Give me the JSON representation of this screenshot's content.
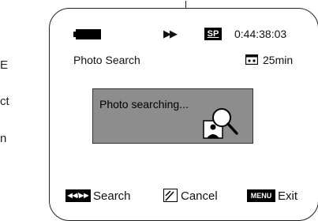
{
  "page": {
    "margin_letters": [
      "E",
      "ct",
      "n"
    ]
  },
  "status": {
    "tape_mode": "SP",
    "timecode": "0:44:38:03",
    "remaining": "25min",
    "play_symbol": "▶▶"
  },
  "screen": {
    "title": "Photo Search"
  },
  "dialog": {
    "message": "Photo searching..."
  },
  "footer": {
    "search_key": "◀◀/▶▶",
    "search_label": "Search",
    "cancel_label": "Cancel",
    "menu_key": "MENU",
    "exit_label": "Exit"
  },
  "icons": {
    "battery": "battery-icon",
    "tape": "cassette-icon",
    "search": "photo-search-icon",
    "cancel": "joystick-icon"
  },
  "colors": {
    "dialog_bg": "#8d8d8d",
    "badge_bg": "#000000"
  }
}
